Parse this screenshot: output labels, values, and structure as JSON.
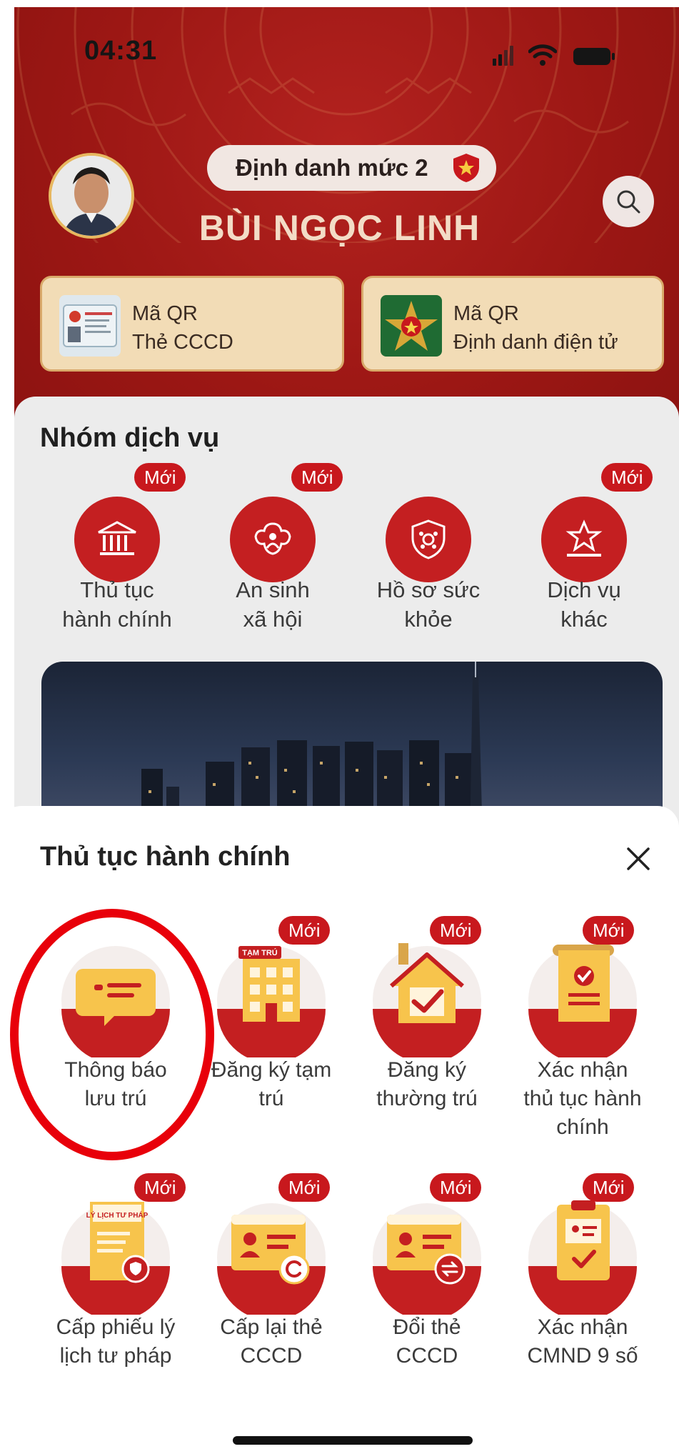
{
  "status_bar": {
    "time": "04:31"
  },
  "profile": {
    "level_label": "Định danh mức 2",
    "name": "BÙI NGỌC LINH"
  },
  "qr_cards": [
    {
      "line1": "Mã QR",
      "line2": "Thẻ CCCD"
    },
    {
      "line1": "Mã QR",
      "line2": "Định danh điện tử"
    }
  ],
  "services": {
    "title": "Nhóm dịch vụ",
    "new_badge": "Mới",
    "items": [
      {
        "line1": "Thủ tục",
        "line2": "hành chính",
        "icon": "bank-icon",
        "is_new": true
      },
      {
        "line1": "An sinh",
        "line2": "xã hội",
        "icon": "family-icon",
        "is_new": true
      },
      {
        "line1": "Hồ sơ sức",
        "line2": "khỏe",
        "icon": "health-shield-icon",
        "is_new": false
      },
      {
        "line1": "Dịch vụ",
        "line2": "khác",
        "icon": "star-podium-icon",
        "is_new": true
      }
    ]
  },
  "sheet": {
    "title": "Thủ tục hành chính",
    "new_badge": "Mới",
    "icon_labels": {
      "temp_stay": "TẠM TRÚ",
      "judicial": "LÝ LỊCH TƯ PHÁP"
    },
    "items": [
      {
        "line1": "Thông báo",
        "line2": "lưu trú",
        "line3": "",
        "icon": "message-icon",
        "is_new": false,
        "highlighted": true
      },
      {
        "line1": "Đăng ký tạm",
        "line2": "trú",
        "line3": "",
        "icon": "building-icon",
        "is_new": true
      },
      {
        "line1": "Đăng ký",
        "line2": "thường trú",
        "line3": "",
        "icon": "house-check-icon",
        "is_new": true
      },
      {
        "line1": "Xác nhận",
        "line2": "thủ tục hành",
        "line3": "chính",
        "icon": "document-check-icon",
        "is_new": true
      },
      {
        "line1": "Cấp phiếu lý",
        "line2": "lịch tư pháp",
        "line3": "",
        "icon": "judicial-record-icon",
        "is_new": true
      },
      {
        "line1": "Cấp lại thẻ",
        "line2": "CCCD",
        "line3": "",
        "icon": "id-card-refresh-icon",
        "is_new": true
      },
      {
        "line1": "Đổi thẻ",
        "line2": "CCCD",
        "line3": "",
        "icon": "id-card-exchange-icon",
        "is_new": true
      },
      {
        "line1": "Xác nhận",
        "line2": "CMND 9 số",
        "line3": "",
        "icon": "clipboard-id-icon",
        "is_new": true
      }
    ]
  },
  "colors": {
    "brand_red": "#c41f21",
    "header_red": "#9c1714",
    "badge_red": "#c8181d",
    "highlight": "#e8000a"
  }
}
